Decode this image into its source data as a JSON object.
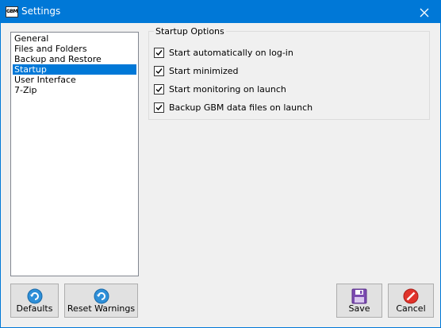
{
  "window": {
    "title": "Settings",
    "app_icon_label": "GBM",
    "accent": "#0078d7"
  },
  "nav": {
    "items": [
      {
        "label": "General",
        "selected": false
      },
      {
        "label": "Files and Folders",
        "selected": false
      },
      {
        "label": "Backup and Restore",
        "selected": false
      },
      {
        "label": "Startup",
        "selected": true
      },
      {
        "label": "User Interface",
        "selected": false
      },
      {
        "label": "7-Zip",
        "selected": false
      }
    ]
  },
  "startup_options": {
    "title": "Startup Options",
    "options": [
      {
        "label": "Start automatically on log-in",
        "checked": true
      },
      {
        "label": "Start minimized",
        "checked": true
      },
      {
        "label": "Start monitoring on launch",
        "checked": true
      },
      {
        "label": "Backup GBM data files on launch",
        "checked": true
      }
    ]
  },
  "buttons": {
    "defaults": {
      "label": "Defaults",
      "icon": "refresh-icon"
    },
    "reset_warnings": {
      "label": "Reset Warnings",
      "icon": "refresh-icon"
    },
    "save": {
      "label": "Save",
      "icon": "floppy-disk-icon"
    },
    "cancel": {
      "label": "Cancel",
      "icon": "cancel-icon"
    }
  }
}
